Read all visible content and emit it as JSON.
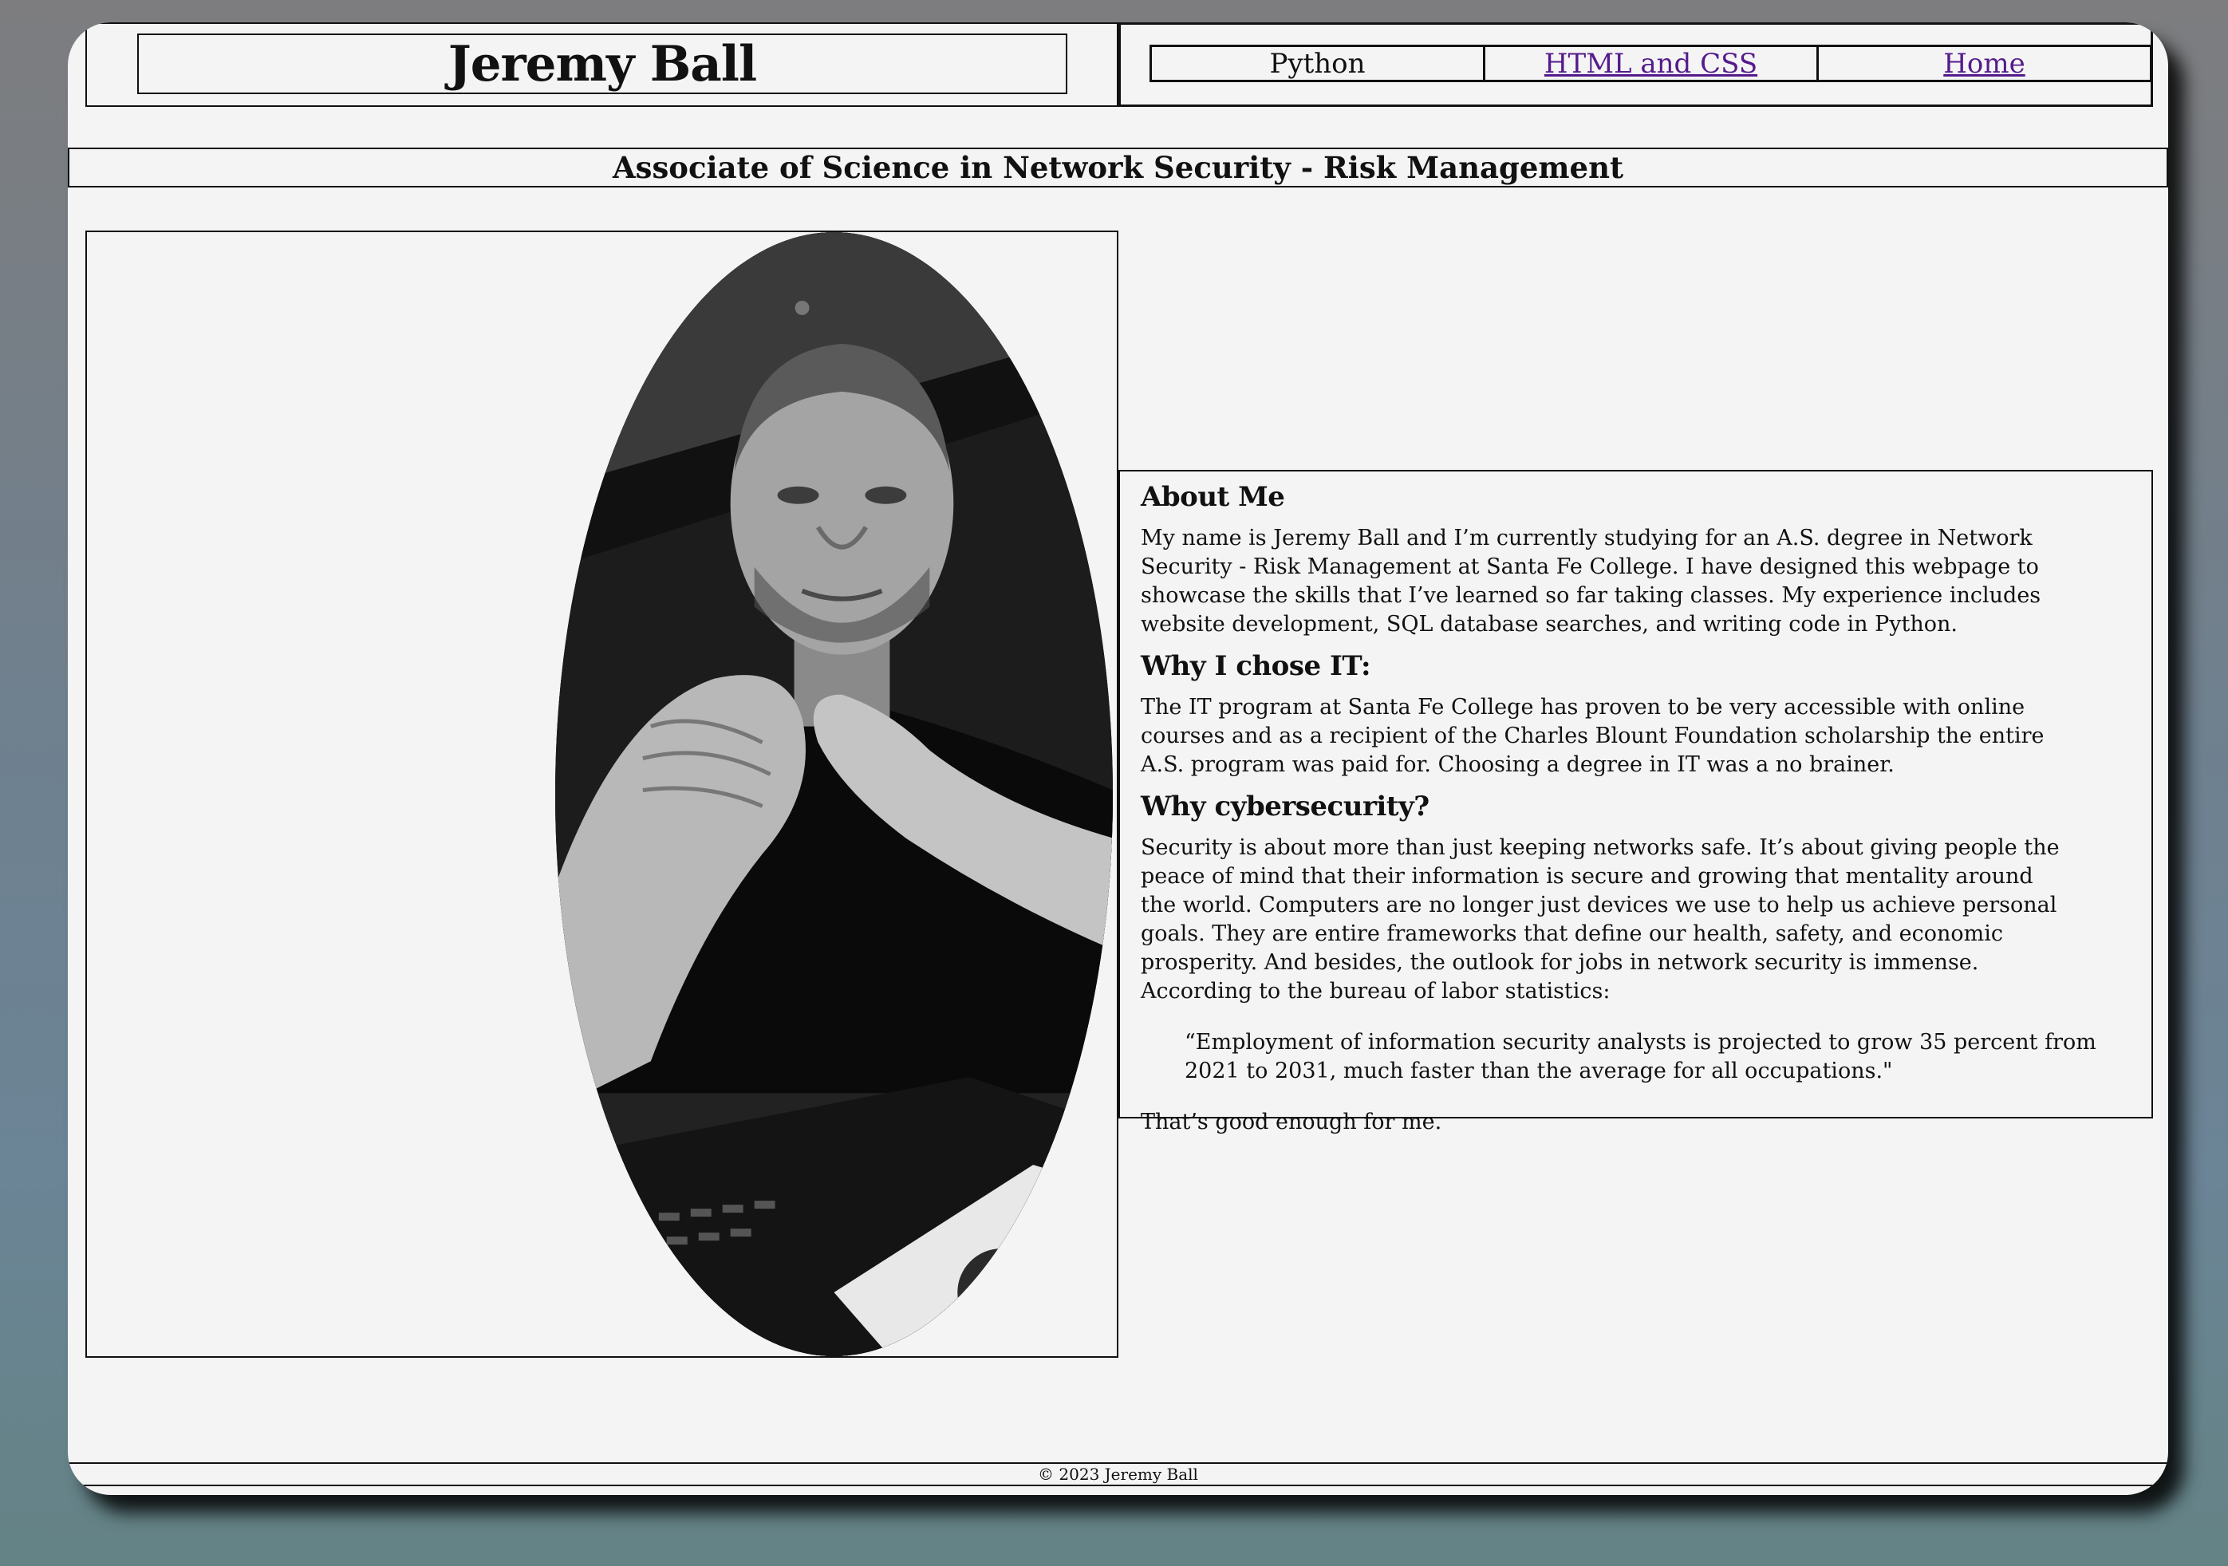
{
  "header": {
    "name": "Jeremy Ball"
  },
  "nav": [
    {
      "label": "Python"
    },
    {
      "label": "HTML and CSS"
    },
    {
      "label": "Home"
    }
  ],
  "degree": "Associate of Science in Network Security - Risk Management",
  "about": {
    "heading": "About Me",
    "intro": "My name is Jeremy Ball and I’m currently studying for an A.S. degree in Network Security - Risk Management at Santa Fe College. I have designed this webpage to showcase the skills that I’ve learned so far taking classes. My experience includes website development, SQL database searches, and writing code in Python.",
    "why_it_heading": "Why I chose IT:",
    "why_it_text": "The IT program at Santa Fe College has proven to be very accessible with online courses and as a recipient of the Charles Blount Foundation scholarship the entire A.S. program was paid for. Choosing a degree in IT was a no brainer.",
    "why_cyber_heading": "Why cybersecurity?",
    "why_cyber_text": "Security is about more than just keeping networks safe. It’s about giving people the peace of mind that their information is secure and growing that mentality around the world. Computers are no longer just devices we use to help us achieve personal goals. They are entire frameworks that define our health, safety, and economic prosperity. And besides, the outlook for jobs in network security is immense. According to the bureau of labor statistics:",
    "quote": "“Employment of information security analysts is projected to grow 35 percent from 2021 to 2031, much faster than the average for all occupations.\"",
    "closing": "That’s good enough for me."
  },
  "footer": "© 2023 Jeremy Ball"
}
